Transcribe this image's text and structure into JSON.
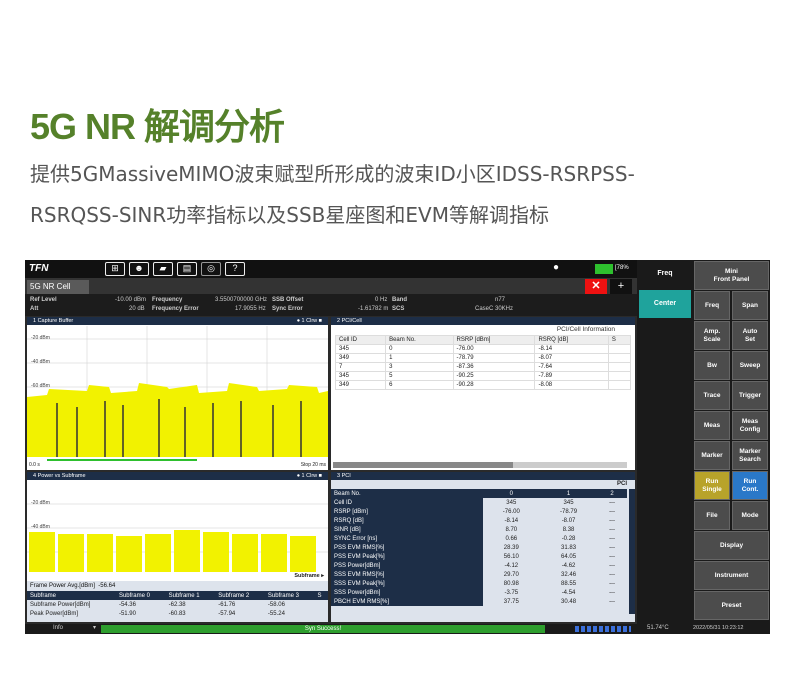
{
  "heading": "5G NR 解调分析",
  "desc": [
    "提供5GMassiveMIMO波束赋型所形成的波束ID小区IDSS-RSRPSS-",
    "RSRQSS-SINR功率指标以及SSB星座图和EVM等解调指标"
  ],
  "logo": "TFN",
  "battery": "[78%",
  "tab": "5G NR Cell",
  "close": "✕",
  "plus": "+",
  "info": {
    "l1a": "Ref Level",
    "l1b": "-10.00 dBm",
    "l1c": "Frequency",
    "l1d": "3.5500700000 GHz",
    "l1e": "SSB Offset",
    "l1f": "0 Hz",
    "l1g": "Band",
    "l1h": "n77",
    "l2a": "Att",
    "l2b": "20 dB",
    "l2c": "Frequency Error",
    "l2d": "17.9055 Hz",
    "l2e": "Sync Error",
    "l2f": "-1.61782 m",
    "l2g": "SCS",
    "l2h": "CaseC 30KHz"
  },
  "p1": {
    "title": "1 Capture Buffer",
    "right": "● 1 Clrw ■",
    "y1": "-20 dBm",
    "y2": "-40 dBm",
    "y3": "-60 dBm",
    "f1": "0.0 s",
    "f2": "Stop 20 ms"
  },
  "p2": {
    "title": "2 PCI/Cell",
    "caption": "PCI/Cell Information",
    "headers": [
      "Cell ID",
      "Beam No.",
      "RSRP [dBm]",
      "RSRQ [dB]",
      "S"
    ],
    "rows": [
      [
        "345",
        "0",
        "-76.00",
        "-8.14"
      ],
      [
        "349",
        "1",
        "-78.79",
        "-8.07"
      ],
      [
        "7",
        "3",
        "-87.36",
        "-7.64"
      ],
      [
        "345",
        "5",
        "-90.25",
        "-7.89"
      ],
      [
        "349",
        "6",
        "-90.28",
        "-8.08"
      ]
    ]
  },
  "p3": {
    "title": "4 Power vs Subframe",
    "right": "● 1 Clrw ■",
    "y1": "-20 dBm",
    "y2": "-40 dBm",
    "xl": "Subframe ▸",
    "rows": [
      [
        "Frame Power Avg.[dBm]",
        "-56.64"
      ],
      [
        "Subframe",
        "Subframe 0",
        "Subframe 1",
        "Subframe 2",
        "Subframe 3",
        "S"
      ],
      [
        "Subframe Power[dBm]",
        "-54.36",
        "-62.38",
        "-61.76",
        "-58.06"
      ],
      [
        "Peak Power[dBm]",
        "-51.90",
        "-60.83",
        "-57.94",
        "-55.24"
      ]
    ]
  },
  "p4": {
    "title": "3 PCI",
    "right": "PCI",
    "headers": [
      "Beam No.",
      "0",
      "1",
      "2"
    ],
    "rows": [
      [
        "Cell ID",
        "345",
        "345",
        "---"
      ],
      [
        "RSRP [dBm]",
        "-76.00",
        "-78.79",
        "---"
      ],
      [
        "RSRQ [dB]",
        "-8.14",
        "-8.07",
        "---"
      ],
      [
        "SINR [dB]",
        "8.70",
        "8.38",
        "---"
      ],
      [
        "SYNC Error [ns]",
        "0.66",
        "-0.28",
        "---"
      ],
      [
        "PSS EVM RMS[%]",
        "28.39",
        "31.83",
        "---"
      ],
      [
        "PSS EVM Peak[%]",
        "56.10",
        "64.05",
        "---"
      ],
      [
        "PSS Power[dBm]",
        "-4.12",
        "-4.62",
        "---"
      ],
      [
        "SSS EVM RMS[%]",
        "29.70",
        "32.46",
        "---"
      ],
      [
        "SSS EVM Peak[%]",
        "80.98",
        "88.55",
        "---"
      ],
      [
        "SSS Power[dBm]",
        "-3.75",
        "-4.54",
        "---"
      ],
      [
        "PBCH EVM RMS[%]",
        "37.75",
        "30.48",
        "---"
      ]
    ]
  },
  "side": {
    "freq": "Freq",
    "center": "Center"
  },
  "keys": [
    [
      "Mini\nFront Panel"
    ],
    [
      "Freq",
      "Span"
    ],
    [
      "Amp.\nScale",
      "Auto\nSet"
    ],
    [
      "Bw",
      "Sweep"
    ],
    [
      "Trace",
      "Trigger"
    ],
    [
      "Meas",
      "Meas\nConfig"
    ],
    [
      "Marker",
      "Marker\nSearch"
    ],
    [
      "Run\nSingle",
      "Run\nCont."
    ],
    [
      "File",
      "Mode"
    ],
    [
      "Display"
    ],
    [
      "Instrument"
    ],
    [
      "Preset"
    ]
  ],
  "status": {
    "info": "Info",
    "sync": "Syn Success!",
    "temp": "51.74°C",
    "time": "2022/05/31 10:23:12"
  },
  "colors": {
    "heading": "#55812a",
    "trace": "#f2f200",
    "accent": "#1fa39c",
    "run_single": "#b8a32a",
    "run_cont": "#2a78c8"
  }
}
